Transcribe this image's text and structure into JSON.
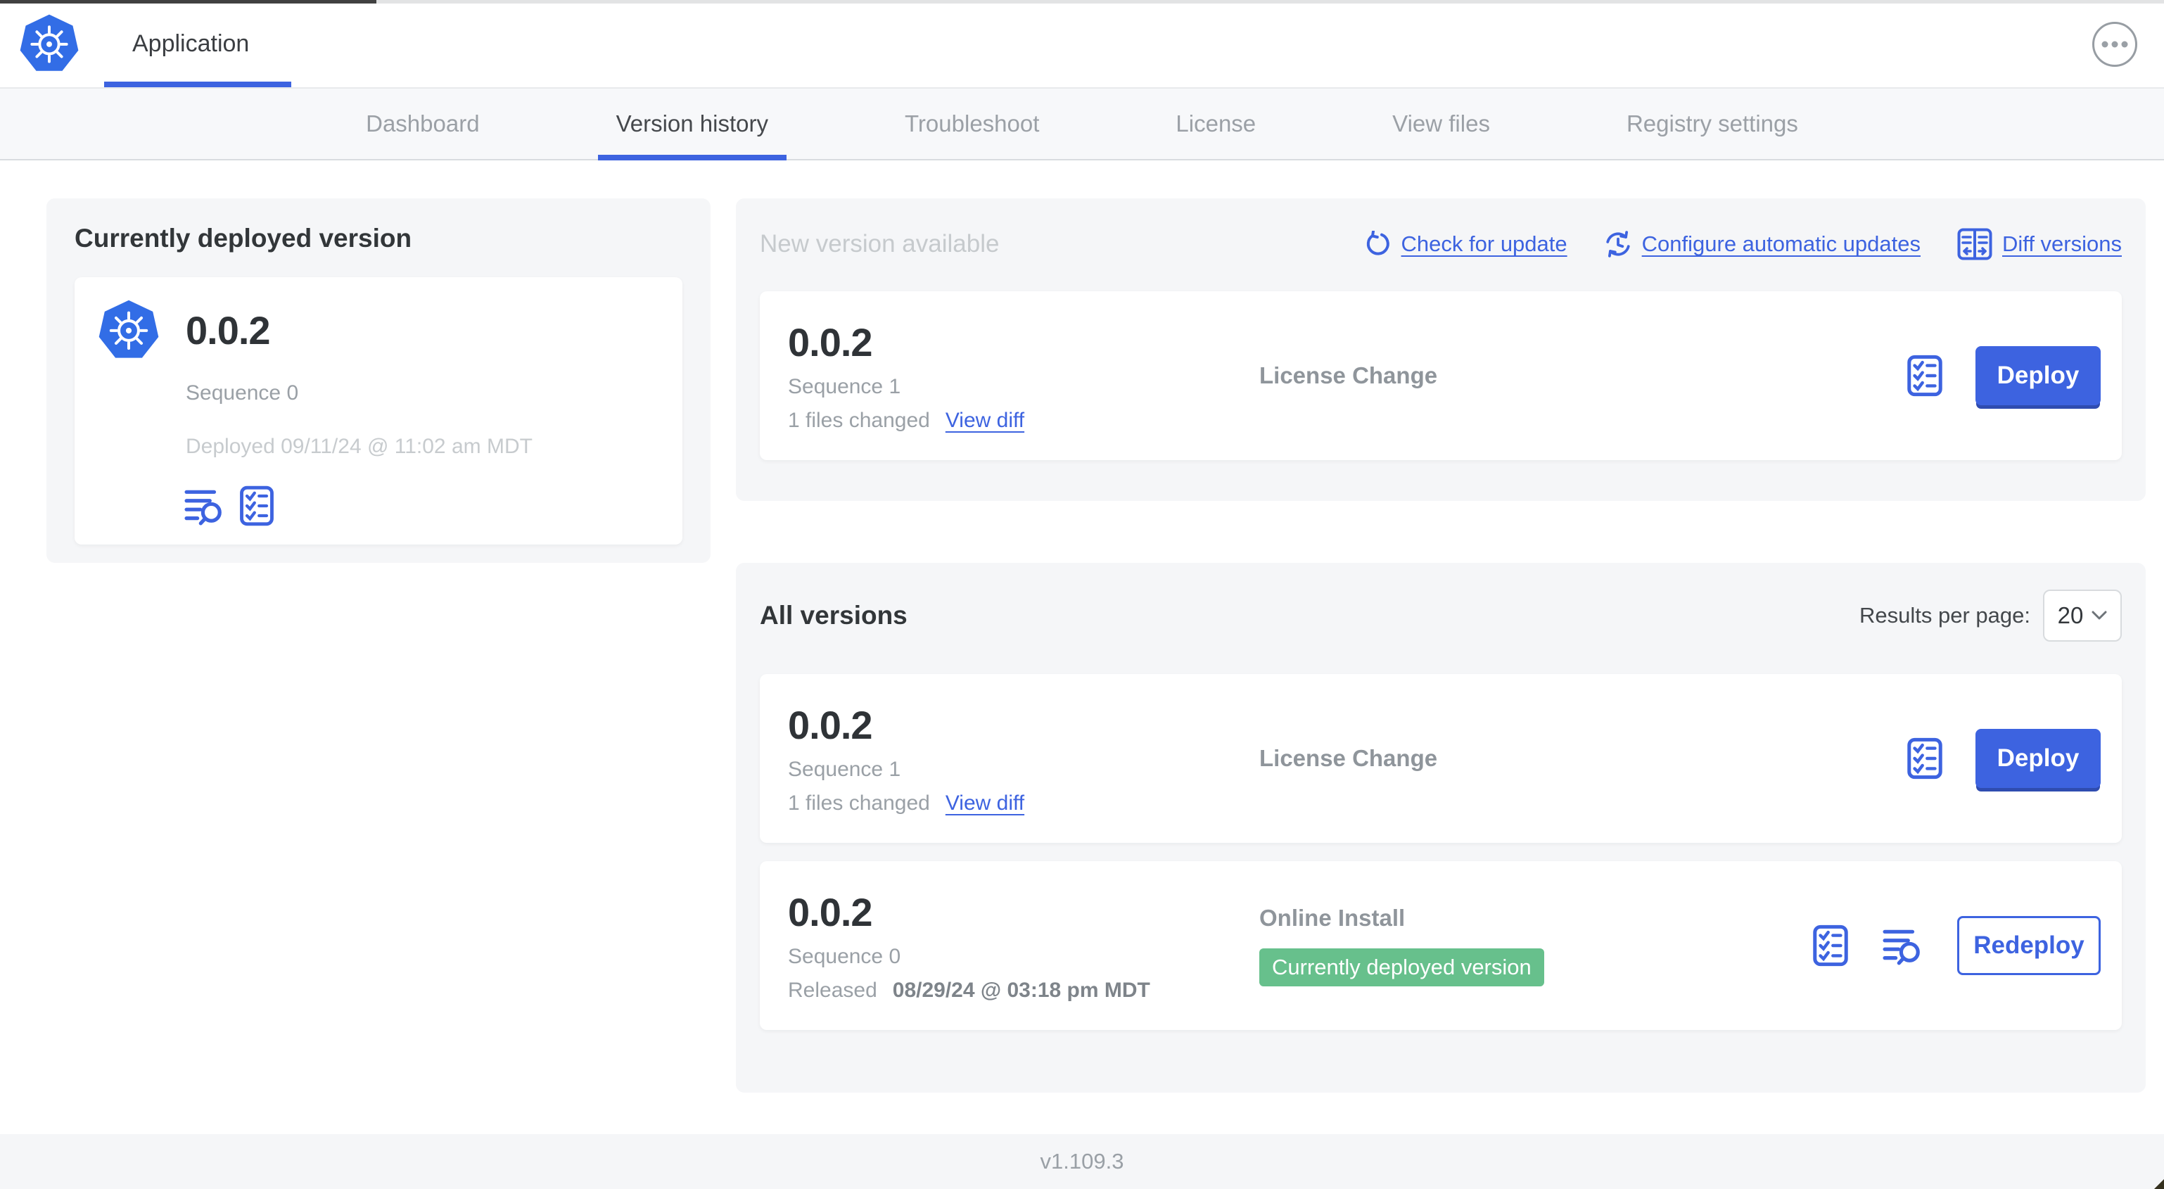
{
  "colors": {
    "accent_blue": "#3d63e0",
    "logo_blue": "#326de6",
    "badge_green": "#67c08c",
    "section_bg": "#f5f6f8",
    "muted_text": "#9aa0a6",
    "light_text": "#c7cbce"
  },
  "header": {
    "app_tab": "Application",
    "menu_icon": "ellipsis-icon",
    "logo_icon": "kubernetes-logo"
  },
  "nav": {
    "tabs": [
      {
        "label": "Dashboard",
        "active": false
      },
      {
        "label": "Version history",
        "active": true
      },
      {
        "label": "Troubleshoot",
        "active": false
      },
      {
        "label": "License",
        "active": false
      },
      {
        "label": "View files",
        "active": false
      },
      {
        "label": "Registry settings",
        "active": false
      }
    ]
  },
  "current_deployed": {
    "title": "Currently deployed version",
    "version": "0.0.2",
    "sequence": "Sequence 0",
    "deployed": "Deployed 09/11/24 @ 11:02 am MDT",
    "icons": [
      "logs-icon",
      "checklist-icon"
    ]
  },
  "new_version": {
    "title": "New version available",
    "actions": [
      {
        "label": "Check for update",
        "icon": "refresh-icon"
      },
      {
        "label": "Configure automatic updates",
        "icon": "schedule-refresh-icon"
      },
      {
        "label": "Diff versions",
        "icon": "diff-icon"
      }
    ],
    "card": {
      "version": "0.0.2",
      "sequence": "Sequence 1",
      "files_changed": "1 files changed",
      "view_diff": "View diff",
      "source": "License Change",
      "action": "Deploy",
      "icons": [
        "checklist-icon"
      ]
    }
  },
  "all_versions": {
    "title": "All versions",
    "results_per_page": {
      "label": "Results per page:",
      "value": "20"
    },
    "rows": [
      {
        "version": "0.0.2",
        "sequence": "Sequence 1",
        "files_changed": "1 files changed",
        "view_diff": "View diff",
        "source": "License Change",
        "action": "Deploy",
        "icons": [
          "checklist-icon"
        ]
      },
      {
        "version": "0.0.2",
        "sequence": "Sequence 0",
        "released_prefix": "Released",
        "released_date": "08/29/24 @ 03:18 pm MDT",
        "source": "Online Install",
        "badge": "Currently deployed version",
        "action": "Redeploy",
        "icons": [
          "checklist-icon",
          "logs-icon"
        ]
      }
    ]
  },
  "footer": {
    "app_version": "v1.109.3"
  }
}
